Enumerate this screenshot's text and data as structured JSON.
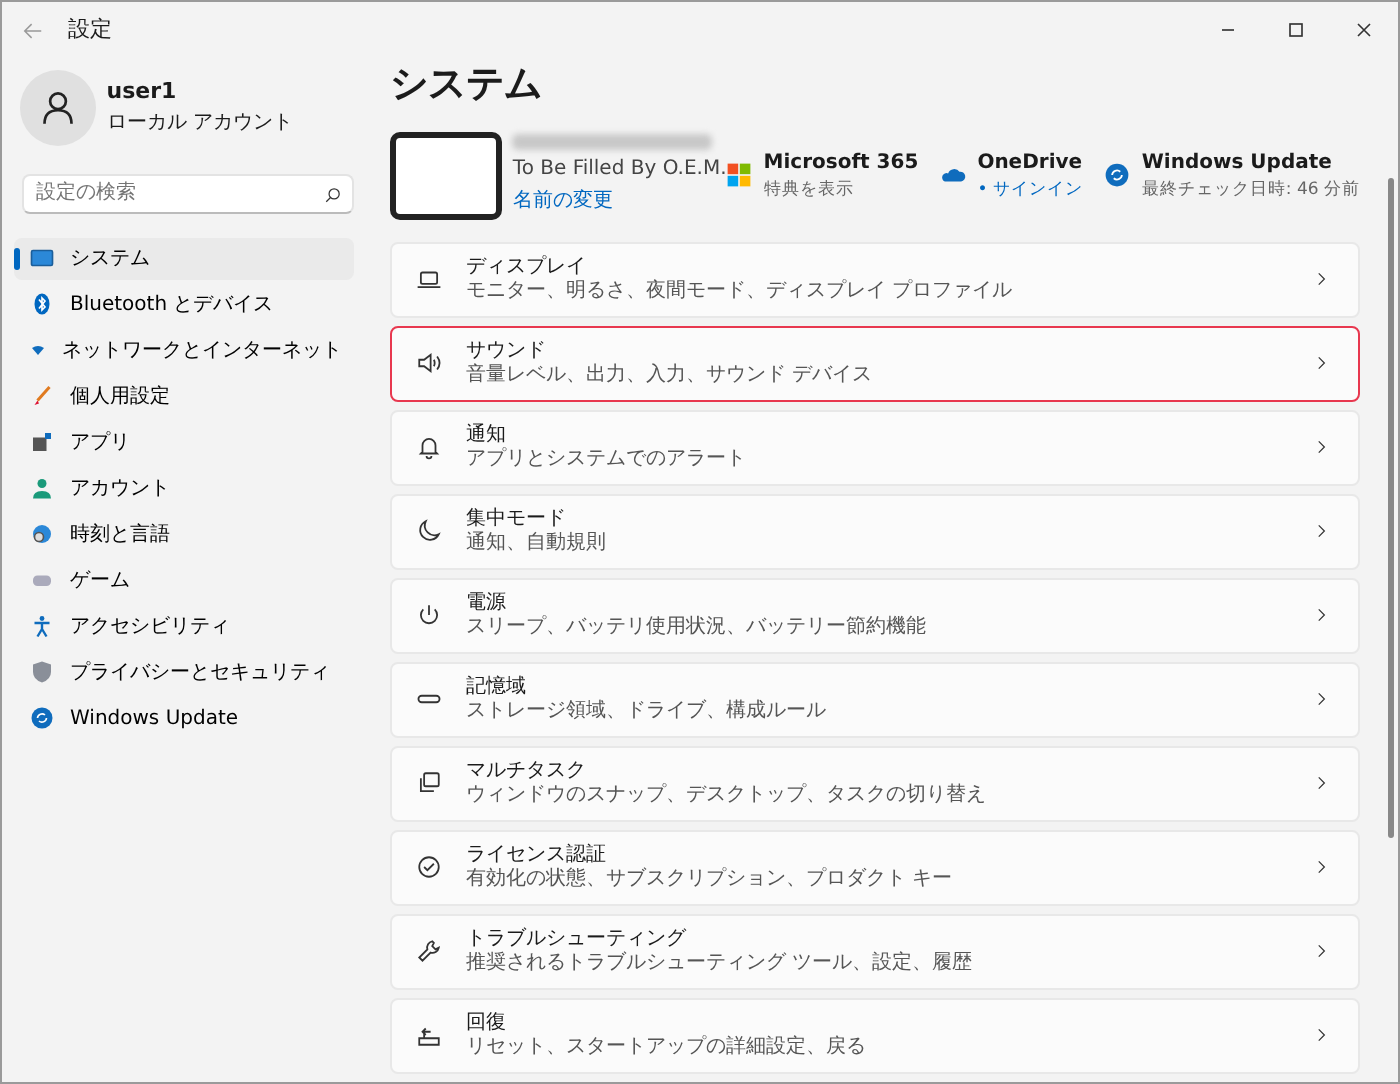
{
  "window": {
    "title": "設定"
  },
  "account": {
    "name": "user1",
    "type": "ローカル アカウント"
  },
  "search": {
    "placeholder": "設定の検索"
  },
  "sidebar": {
    "items": [
      {
        "label": "システム",
        "selected": true
      },
      {
        "label": "Bluetooth とデバイス",
        "selected": false
      },
      {
        "label": "ネットワークとインターネット",
        "selected": false
      },
      {
        "label": "個人用設定",
        "selected": false
      },
      {
        "label": "アプリ",
        "selected": false
      },
      {
        "label": "アカウント",
        "selected": false
      },
      {
        "label": "時刻と言語",
        "selected": false
      },
      {
        "label": "ゲーム",
        "selected": false
      },
      {
        "label": "アクセシビリティ",
        "selected": false
      },
      {
        "label": "プライバシーとセキュリティ",
        "selected": false
      },
      {
        "label": "Windows Update",
        "selected": false
      }
    ]
  },
  "page_title": "システム",
  "device": {
    "model": "To Be Filled By O.E.M.",
    "rename_link": "名前の変更"
  },
  "quick_links": [
    {
      "title": "Microsoft 365",
      "subtitle": "特典を表示"
    },
    {
      "title": "OneDrive",
      "subtitle": "• サインイン"
    },
    {
      "title": "Windows Update",
      "subtitle": "最終チェック日時: 46 分前"
    }
  ],
  "settings": [
    {
      "title": "ディスプレイ",
      "subtitle": "モニター、明るさ、夜間モード、ディスプレイ プロファイル",
      "highlighted": false
    },
    {
      "title": "サウンド",
      "subtitle": "音量レベル、出力、入力、サウンド デバイス",
      "highlighted": true
    },
    {
      "title": "通知",
      "subtitle": "アプリとシステムでのアラート",
      "highlighted": false
    },
    {
      "title": "集中モード",
      "subtitle": "通知、自動規則",
      "highlighted": false
    },
    {
      "title": "電源",
      "subtitle": "スリープ、バッテリ使用状況、バッテリー節約機能",
      "highlighted": false
    },
    {
      "title": "記憶域",
      "subtitle": "ストレージ領域、ドライブ、構成ルール",
      "highlighted": false
    },
    {
      "title": "マルチタスク",
      "subtitle": "ウィンドウのスナップ、デスクトップ、タスクの切り替え",
      "highlighted": false
    },
    {
      "title": "ライセンス認証",
      "subtitle": "有効化の状態、サブスクリプション、プロダクト キー",
      "highlighted": false
    },
    {
      "title": "トラブルシューティング",
      "subtitle": "推奨されるトラブルシューティング ツール、設定、履歴",
      "highlighted": false
    },
    {
      "title": "回復",
      "subtitle": "リセット、スタートアップの詳細設定、戻る",
      "highlighted": false
    }
  ]
}
